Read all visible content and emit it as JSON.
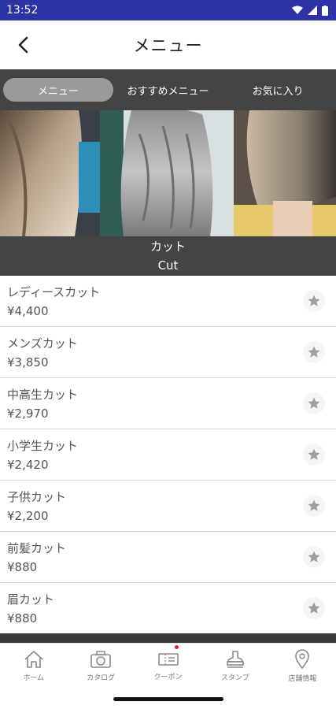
{
  "status_bar": {
    "time": "13:52",
    "bg_color": "#2b33a5"
  },
  "header": {
    "title": "メニュー",
    "back_icon": "chevron-left-icon"
  },
  "tabs": [
    {
      "label": "メニュー",
      "active": true
    },
    {
      "label": "おすすめメニュー",
      "active": false
    },
    {
      "label": "お気に入り",
      "active": false
    }
  ],
  "category": {
    "name_jp": "カット",
    "name_en": "Cut"
  },
  "menu_items": [
    {
      "name": "レディースカット",
      "price": "¥4,400"
    },
    {
      "name": "メンズカット",
      "price": "¥3,850"
    },
    {
      "name": "中高生カット",
      "price": "¥2,970"
    },
    {
      "name": "小学生カット",
      "price": "¥2,420"
    },
    {
      "name": "子供カット",
      "price": "¥2,200"
    },
    {
      "name": "前髪カット",
      "price": "¥880"
    },
    {
      "name": "眉カット",
      "price": "¥880"
    }
  ],
  "bottom_nav": [
    {
      "label": "ホーム",
      "icon": "home-icon"
    },
    {
      "label": "カタログ",
      "icon": "camera-icon"
    },
    {
      "label": "クーポン",
      "icon": "coupon-icon",
      "badge": true
    },
    {
      "label": "スタンプ",
      "icon": "stamp-icon"
    },
    {
      "label": "店舗情報",
      "icon": "location-icon"
    }
  ],
  "colors": {
    "tab_bar": "#444444",
    "active_tab": "#9a9a9a",
    "badge": "#e02020"
  }
}
